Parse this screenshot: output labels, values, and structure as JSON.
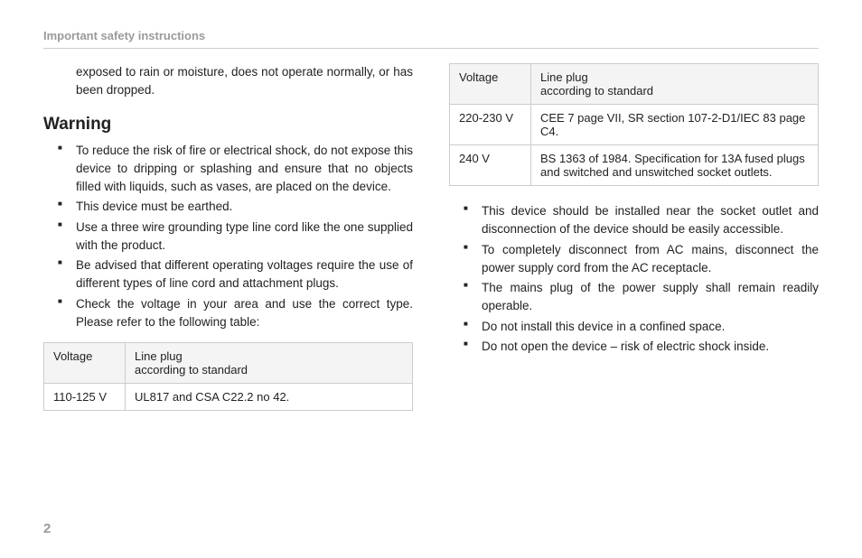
{
  "header": {
    "title": "Important safety instructions"
  },
  "leftColumn": {
    "introText": "exposed to rain or moisture, does not operate normally, or has been dropped.",
    "warningHeading": "Warning",
    "bullets": [
      "To reduce the risk of fire or electrical shock, do not expose this device to dripping or splashing and ensure that no objects filled with liquids, such as vases, are placed on the device.",
      "This device must be earthed.",
      "Use a three wire grounding type line cord like the one supplied with the product.",
      "Be advised that different operating voltages require the use of different types of line cord and attachment plugs.",
      "Check the voltage in your area and use the correct type. Please refer to the following table:"
    ],
    "table": {
      "headers": {
        "col1": "Voltage",
        "col2a": "Line plug",
        "col2b": "according to standard"
      },
      "rows": [
        {
          "voltage": "110-125 V",
          "plug": "UL817 and CSA C22.2 no 42."
        }
      ]
    }
  },
  "rightColumn": {
    "table": {
      "headers": {
        "col1": "Voltage",
        "col2a": "Line plug",
        "col2b": "according to standard"
      },
      "rows": [
        {
          "voltage": "220-230 V",
          "plug": "CEE 7 page VII, SR section 107-2-D1/IEC 83 page C4."
        },
        {
          "voltage": "240 V",
          "plug": "BS 1363 of 1984. Specification for 13A fused plugs and switched and unswitched socket outlets."
        }
      ]
    },
    "bullets": [
      "This device should be installed near the socket outlet and disconnection of the device should be easily accessible.",
      "To completely disconnect from AC mains, disconnect the power supply cord from the AC receptacle.",
      "The mains plug of the power supply shall remain readily operable.",
      "Do not install this device in a confined space.",
      "Do not open the device – risk of electric shock inside."
    ]
  },
  "pageNumber": "2"
}
